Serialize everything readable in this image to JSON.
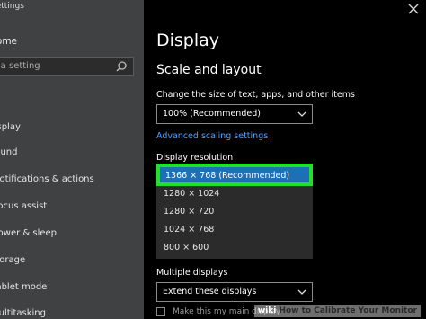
{
  "sidebar": {
    "title": "Settings",
    "home": "Home",
    "search_placeholder": "Find a setting",
    "items": [
      {
        "label": "Display"
      },
      {
        "label": "Sound"
      },
      {
        "label": "Notifications & actions"
      },
      {
        "label": "Focus assist"
      },
      {
        "label": "Power & sleep"
      },
      {
        "label": "Storage"
      },
      {
        "label": "Tablet mode"
      },
      {
        "label": "Multitasking"
      }
    ]
  },
  "main": {
    "heading": "Display",
    "section": "Scale and layout",
    "scale_label": "Change the size of text, apps, and other items",
    "scale_value": "100% (Recommended)",
    "advanced_link": "Advanced scaling settings",
    "resolution_label": "Display resolution",
    "resolution_options": [
      "1366 × 768 (Recommended)",
      "1280 × 1024",
      "1280 × 720",
      "1024 × 768",
      "800 × 600"
    ],
    "multiple_label": "Multiple displays",
    "multiple_value": "Extend these displays",
    "main_display_checkbox": "Make this my main display"
  },
  "watermark": {
    "brand": "wiki",
    "text": "How to Calibrate Your Monitor"
  },
  "colors": {
    "accent": "#1f6fb5",
    "highlight": "#22e02a",
    "link": "#4ea1ff"
  }
}
